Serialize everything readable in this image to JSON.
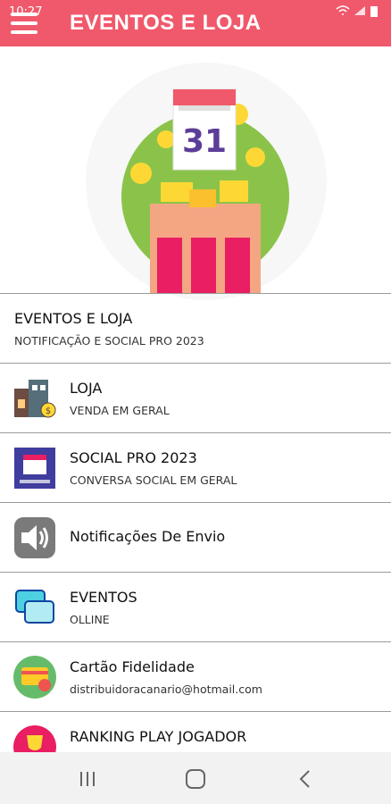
{
  "status": {
    "time": "10:27"
  },
  "appbar": {
    "title": "EVENTOS E LOJA"
  },
  "hero": {
    "calendar_number": "31"
  },
  "list": [
    {
      "title": "EVENTOS E LOJA",
      "subtitle": "NOTIFICAÇÃO E SOCIAL PRO 2023"
    },
    {
      "title": "LOJA",
      "subtitle": "VENDA EM GERAL",
      "icon": "store-building-icon"
    },
    {
      "title": "SOCIAL PRO 2023",
      "subtitle": "CONVERSA SOCIAL EM GERAL",
      "icon": "calendar-app-icon"
    },
    {
      "title": "Notificações De Envio",
      "subtitle": "",
      "icon": "speaker-icon"
    },
    {
      "title": "EVENTOS",
      "subtitle": "OLLINE",
      "icon": "chat-bubbles-icon"
    },
    {
      "title": "Cartão Fidelidade",
      "subtitle": "distribuidoracanario@hotmail.com",
      "icon": "loyalty-card-icon"
    },
    {
      "title": "RANKING PLAY JOGADOR",
      "subtitle": "",
      "icon": "trophy-icon"
    }
  ],
  "navbar": {
    "buttons": [
      "recents-icon",
      "home-icon",
      "back-icon"
    ]
  },
  "colors": {
    "appbar": "#f0596b",
    "accent_green": "#8bc34a",
    "store_pink": "#e91e63"
  }
}
